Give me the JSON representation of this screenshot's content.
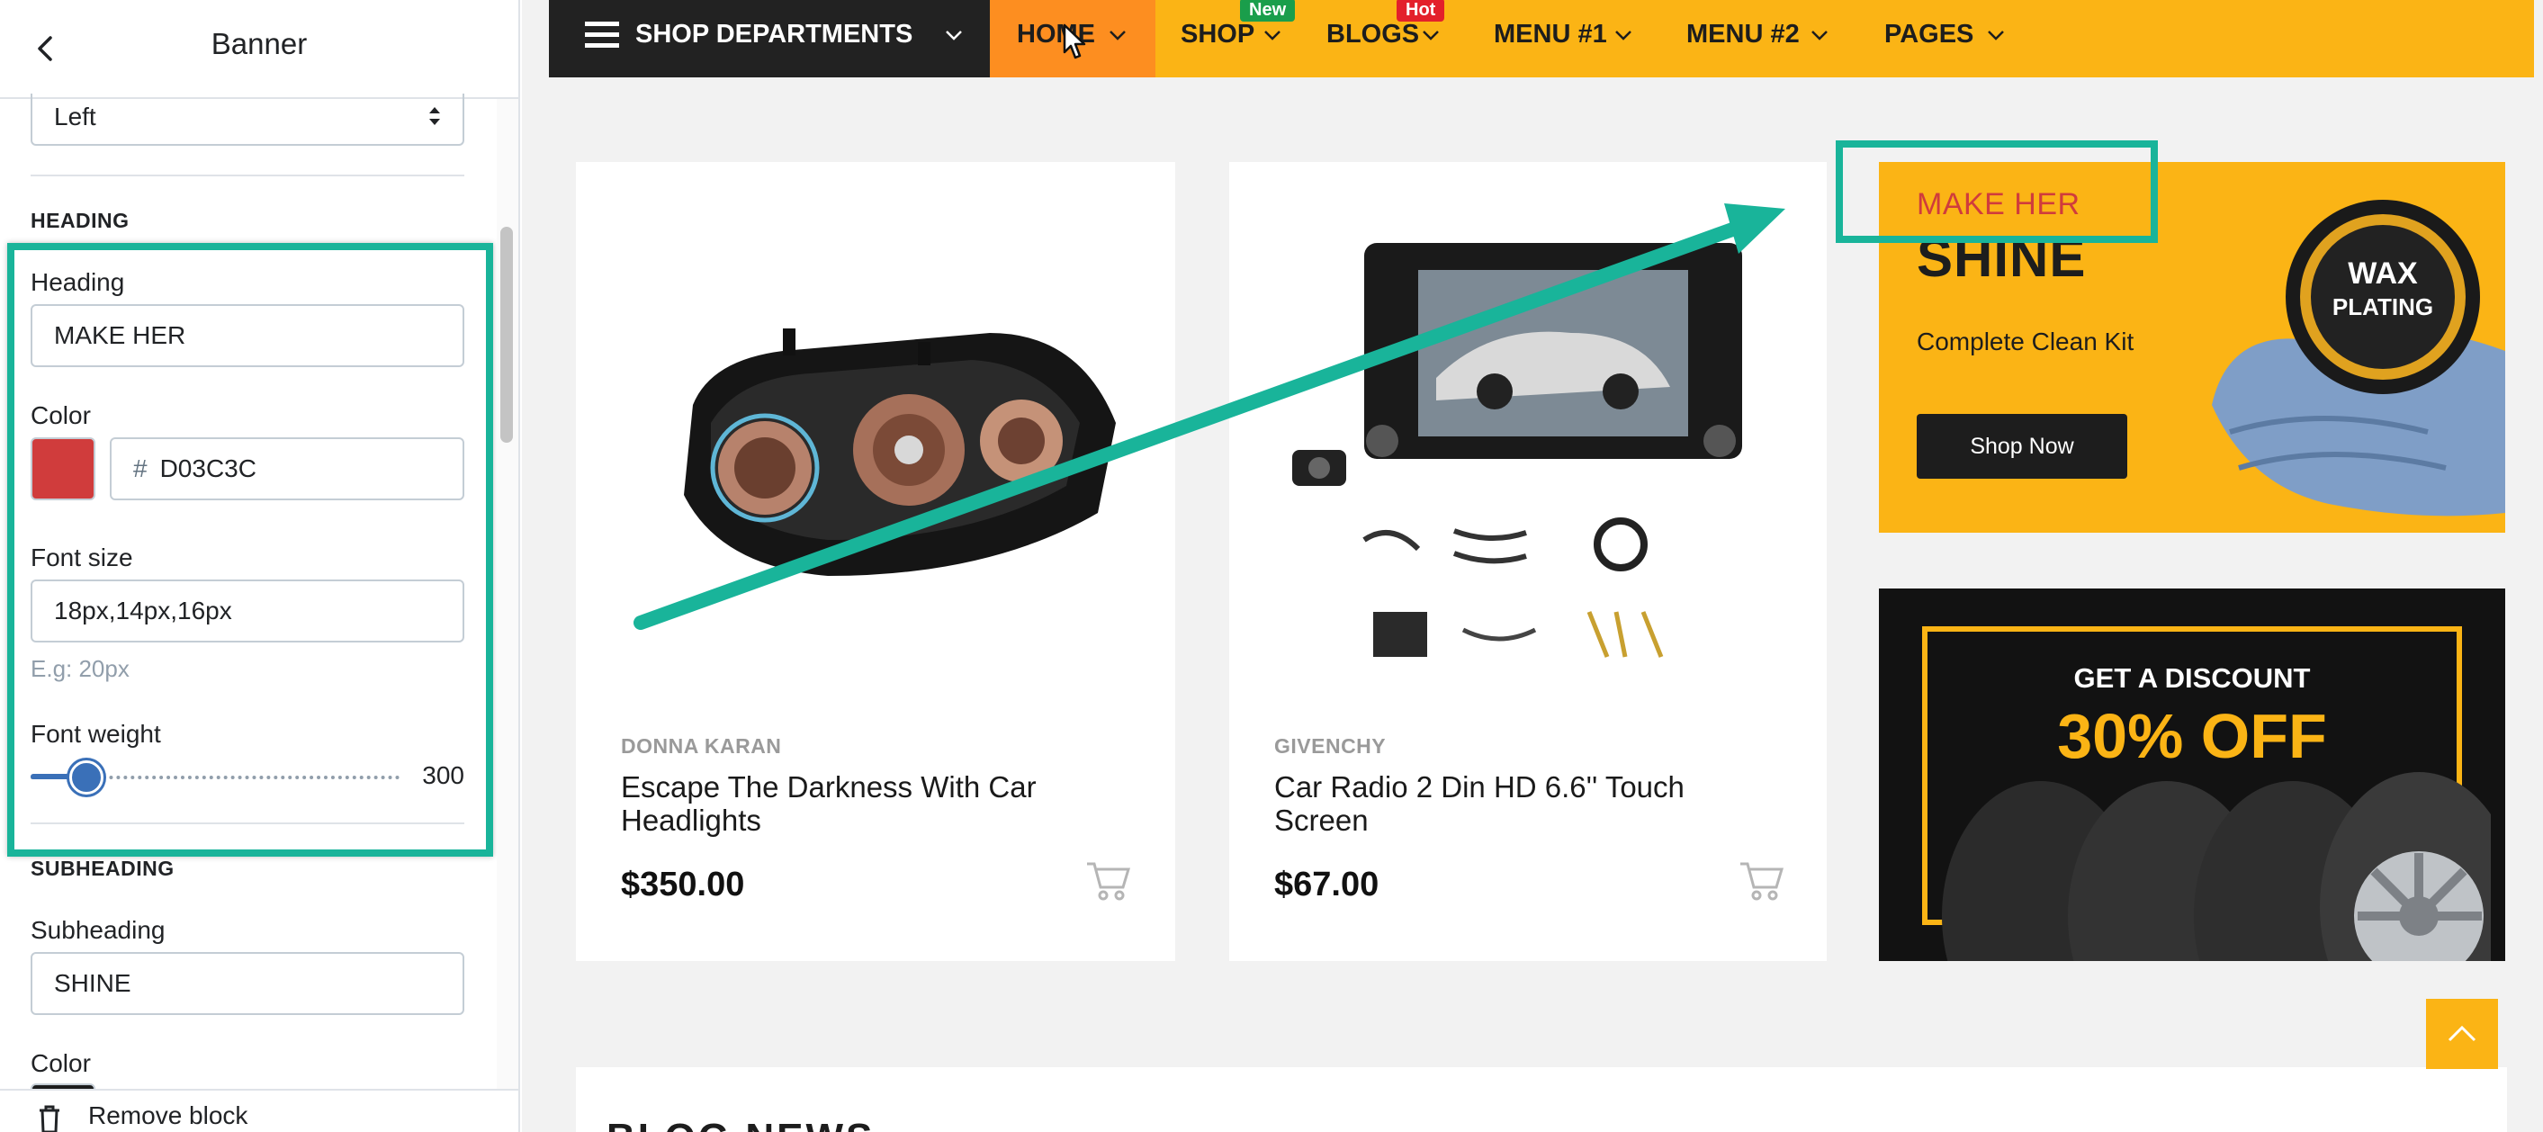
{
  "panel": {
    "title": "Banner",
    "alignment_value": "Left",
    "heading_section": {
      "label": "HEADING",
      "heading_label": "Heading",
      "heading_value": "MAKE HER",
      "color_label": "Color",
      "color_hash": "#",
      "color_value": "D03C3C",
      "color_hex": "#d03c3c",
      "font_size_label": "Font size",
      "font_size_value": "18px,14px,16px",
      "font_size_help": "E.g: 20px",
      "font_weight_label": "Font weight",
      "font_weight_value": "300",
      "font_weight_fraction": 0.15
    },
    "subheading_section": {
      "label": "SUBHEADING",
      "subheading_label": "Subheading",
      "subheading_value": "SHINE",
      "color_label": "Color"
    },
    "footer": {
      "remove_label": "Remove block"
    }
  },
  "nav": {
    "departments_label": "SHOP DEPARTMENTS",
    "items": [
      {
        "label": "HOME"
      },
      {
        "label": "SHOP",
        "badge": "New"
      },
      {
        "label": "BLOGS",
        "badge": "Hot"
      },
      {
        "label": "MENU #1"
      },
      {
        "label": "MENU #2"
      },
      {
        "label": "PAGES"
      }
    ]
  },
  "products": [
    {
      "brand": "DONNA KARAN",
      "title": "Escape The Darkness With Car Headlights",
      "price": "$350.00"
    },
    {
      "brand": "GIVENCHY",
      "title": "Car Radio 2 Din HD 6.6'' Touch Screen",
      "price": "$67.00"
    }
  ],
  "banner": {
    "heading": "MAKE HER",
    "subheading": "SHINE",
    "text": "Complete Clean Kit",
    "button": "Shop Now",
    "product_label_1": "WAX",
    "product_label_2": "PLATING"
  },
  "discount": {
    "line1": "GET A DISCOUNT",
    "line2": "30% OFF"
  },
  "blog": {
    "heading": "BLOG NEWS"
  },
  "colors": {
    "accent_yellow": "#fbb415",
    "home_orange": "#fd8e20",
    "annotation_teal": "#19b49a",
    "slider_blue": "#3a70b8",
    "badge_new": "#1a9e4b",
    "badge_hot": "#e3202b"
  },
  "icons": {
    "back": "chevron-left-icon",
    "menu": "hamburger-menu-icon",
    "cart": "shopping-cart-icon",
    "scroll_top": "chevron-up-icon",
    "remove": "trash-icon"
  }
}
